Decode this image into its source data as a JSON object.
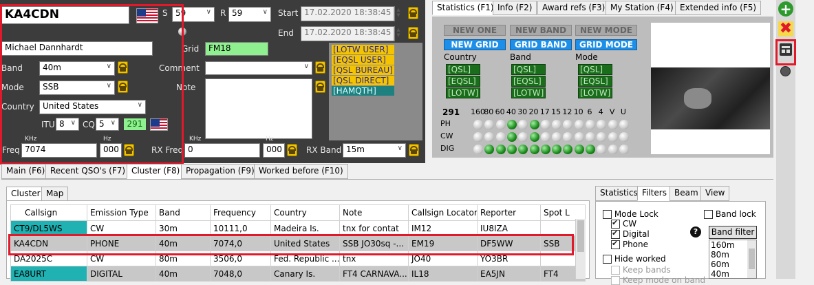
{
  "qso": {
    "callsign": "KA4CDN",
    "s_label": "S",
    "s_value": "59",
    "r_label": "R",
    "r_value": "59",
    "start_label": "Start",
    "start_value": "17.02.2020 18:38:45",
    "end_label": "End",
    "end_value": "17.02.2020 18:38:45",
    "name_value": "Michael  Dannhardt",
    "grid_label": "Grid",
    "grid_value": "FM18",
    "band_label": "Band",
    "band_value": "40m",
    "comment_label": "Comment",
    "mode_label": "Mode",
    "mode_value": "SSB",
    "note_label": "Note",
    "country_label": "Country",
    "country_value": "United States",
    "itu_label": "ITU",
    "itu_value": "8",
    "cq_label": "CQ",
    "cq_value": "5",
    "dxcc_count": "291",
    "khz_label": "KHz",
    "hz_label": "Hz",
    "freq_label": "Freq",
    "freq_value": "7074",
    "freq_hz": "000",
    "rxfreq_label": "RX Freq",
    "rxfreq_value": "0",
    "rxfreq_hz": "000",
    "rxband_label": "RX Band",
    "rxband_value": "15m"
  },
  "qsl_tags": [
    {
      "label": "[LOTW USER]",
      "style": "yellow"
    },
    {
      "label": "[EQSL USER]",
      "style": "yellow"
    },
    {
      "label": "[QSL BUREAU]",
      "style": "yellow"
    },
    {
      "label": "[QSL DIRECT]",
      "style": "yellow"
    },
    {
      "label": "[HAMQTH]",
      "style": "teal"
    }
  ],
  "right_tabs": [
    "Statistics (F1)",
    "Info (F2)",
    "Award refs (F3)",
    "My Station (F4)",
    "Extended info (F5)"
  ],
  "stats": {
    "new_one": "NEW ONE",
    "new_band": "NEW BAND",
    "new_mode": "NEW MODE",
    "new_grid": "NEW GRID",
    "grid_band": "GRID BAND",
    "grid_mode": "GRID MODE",
    "col_country": "Country",
    "col_band": "Band",
    "col_mode": "Mode",
    "tag_qsl": "[QSL]",
    "tag_eqsl": "[EQSL]",
    "tag_lotw": "[LOTW]",
    "count": "291",
    "bands": [
      "160",
      "80",
      "60",
      "40",
      "30",
      "20",
      "17",
      "15",
      "12",
      "10",
      "6",
      "4",
      "V",
      "U"
    ],
    "rows": [
      {
        "label": "PH",
        "status": [
          "white",
          "white",
          "white",
          "green",
          "white",
          "green",
          "white",
          "white",
          "white",
          "white",
          "white",
          "white",
          "white",
          "white"
        ]
      },
      {
        "label": "CW",
        "status": [
          "white",
          "white",
          "white",
          "green",
          "white",
          "green",
          "white",
          "white",
          "white",
          "white",
          "white",
          "white",
          "white",
          "white"
        ]
      },
      {
        "label": "DIG",
        "status": [
          "white",
          "green",
          "green",
          "green",
          "green",
          "green",
          "green",
          "green",
          "green",
          "green",
          "green",
          "white",
          "white",
          "white"
        ]
      }
    ]
  },
  "bottom_tabs": [
    "Main (F6)",
    "Recent QSO's (F7)",
    "Cluster (F8)",
    "Propagation (F9)",
    "Worked before (F10)"
  ],
  "cluster_tabs": [
    "Cluster",
    "Map"
  ],
  "cluster": {
    "headers": [
      "Callsign",
      "Emission Type",
      "Band",
      "Frequency",
      "Country",
      "Note",
      "Callsign Locator",
      "Reporter",
      "Spot L"
    ],
    "rows": [
      [
        "CT9/DL5WS",
        "CW",
        "30m",
        "10111,0",
        "Madeira Is.",
        "tnx for contat",
        "IM12",
        "IU8IZA",
        ""
      ],
      [
        "KA4CDN",
        "PHONE",
        "40m",
        "7074,0",
        "United States",
        "SSB JO30sq -...",
        "EM19",
        "DF5WW",
        "SSB"
      ],
      [
        "DA2025C",
        "CW",
        "80m",
        "3506,0",
        "Fed. Republic ...",
        "tnx",
        "JO40",
        "YO3BR",
        ""
      ],
      [
        "EA8URT",
        "DIGITAL",
        "40m",
        "7048,0",
        "Canary Is.",
        "FT4 CARNAVA...",
        "IL18",
        "EA5JN",
        "FT4"
      ]
    ]
  },
  "filter_tabs": [
    "Statistics",
    "Filters",
    "Beam",
    "View"
  ],
  "filters": {
    "mode_lock": "Mode Lock",
    "cw": "CW",
    "digital": "Digital",
    "phone": "Phone",
    "band_lock": "Band lock",
    "band_filter": "Band filter",
    "band_list": [
      "160m",
      "80m",
      "60m",
      "40m"
    ],
    "hide_worked": "Hide worked",
    "keep_bands": "Keep bands",
    "keep_mode": "Keep mode on band"
  },
  "colors": {
    "highlight_red": "#e0192b",
    "dark_bg": "#3c3c3c",
    "teal_cell": "#20b2b2",
    "accent_blue": "#1e8fe8"
  }
}
